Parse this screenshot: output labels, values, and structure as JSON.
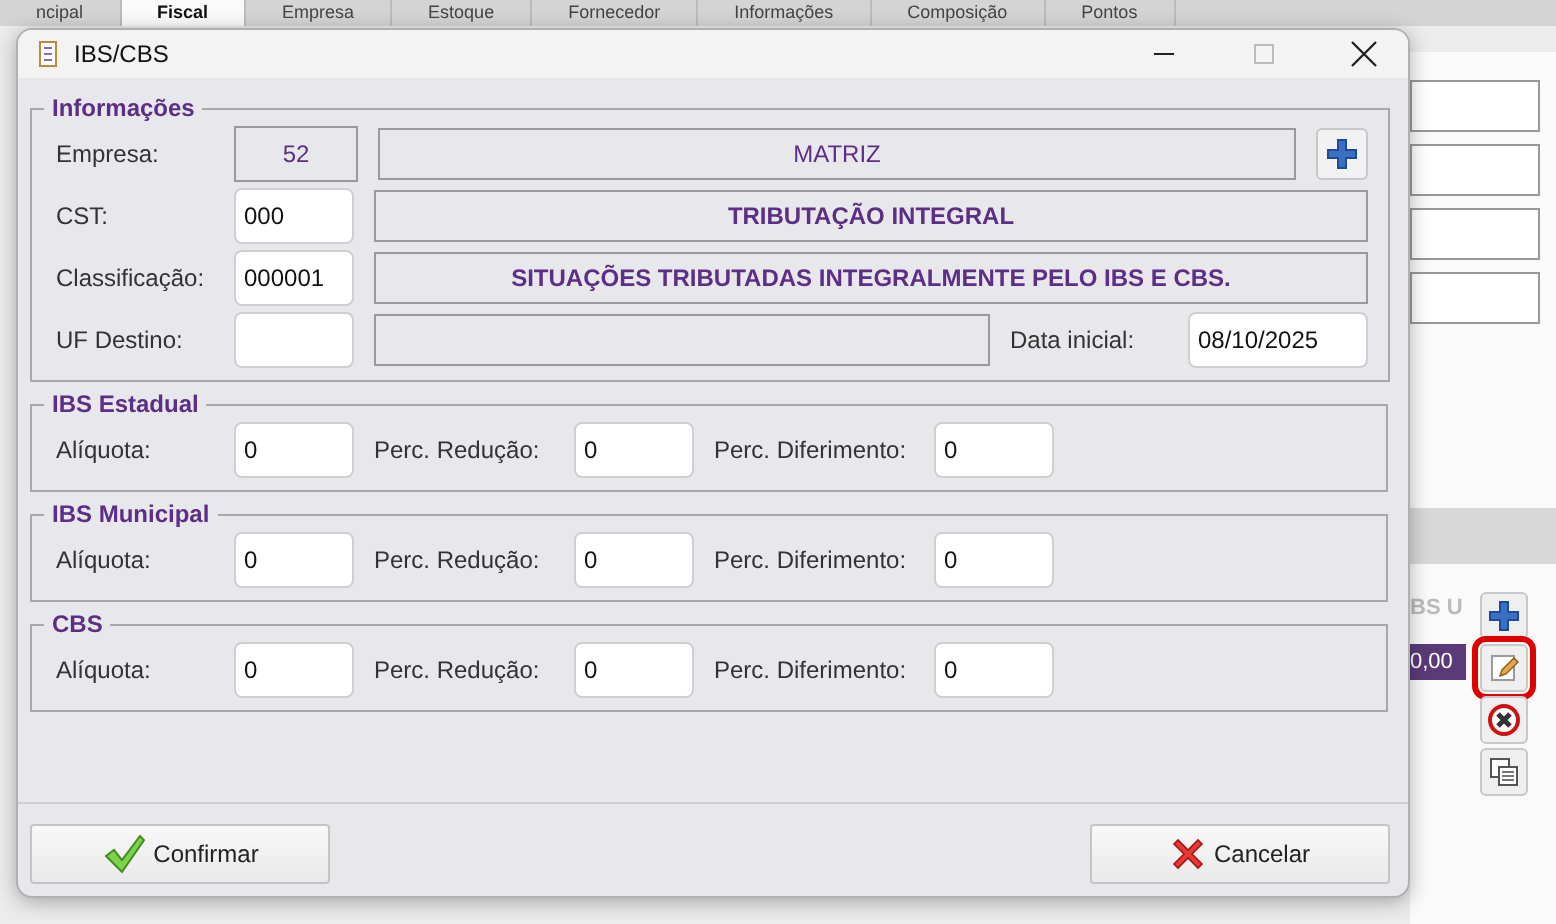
{
  "background": {
    "tabs": [
      {
        "label": "ncipal",
        "selected": false
      },
      {
        "label": "Fiscal",
        "selected": true
      },
      {
        "label": "Empresa",
        "selected": false
      },
      {
        "label": "Estoque",
        "selected": false
      },
      {
        "label": "Fornecedor",
        "selected": false
      },
      {
        "label": "Informações",
        "selected": false
      },
      {
        "label": "Composição",
        "selected": false
      },
      {
        "label": "Pontos",
        "selected": false
      }
    ],
    "table": {
      "header": "BS U",
      "cell": "0,00"
    },
    "side_buttons": [
      {
        "kind": "add",
        "highlighted": false
      },
      {
        "kind": "edit",
        "highlighted": true
      },
      {
        "kind": "delete",
        "highlighted": false
      },
      {
        "kind": "copy",
        "highlighted": false
      }
    ]
  },
  "window": {
    "title": "IBS/CBS"
  },
  "info": {
    "title": "Informações",
    "empresa": {
      "label": "Empresa:",
      "code": "52",
      "name": "MATRIZ"
    },
    "cst": {
      "label": "CST:",
      "code": "000",
      "description": "TRIBUTAÇÃO INTEGRAL"
    },
    "classificacao": {
      "label": "Classificação:",
      "code": "000001",
      "description": "SITUAÇÕES TRIBUTADAS INTEGRALMENTE PELO IBS E CBS."
    },
    "uf_destino": {
      "label": "UF Destino:"
    },
    "data_inicial": {
      "label": "Data inicial:",
      "value": "08/10/2025"
    }
  },
  "groups": [
    {
      "title": "IBS Estadual",
      "fields": [
        {
          "label": "Alíquota:",
          "value": "0"
        },
        {
          "label": "Perc. Redução:",
          "value": "0"
        },
        {
          "label": "Perc. Diferimento:",
          "value": "0"
        }
      ]
    },
    {
      "title": "IBS Municipal",
      "fields": [
        {
          "label": "Alíquota:",
          "value": "0"
        },
        {
          "label": "Perc. Redução:",
          "value": "0"
        },
        {
          "label": "Perc. Diferimento:",
          "value": "0"
        }
      ]
    },
    {
      "title": "CBS",
      "fields": [
        {
          "label": "Alíquota:",
          "value": "0"
        },
        {
          "label": "Perc. Redução:",
          "value": "0"
        },
        {
          "label": "Perc. Diferimento:",
          "value": "0"
        }
      ]
    }
  ],
  "buttons": [
    {
      "kind": "confirm",
      "label": "Confirmar"
    },
    {
      "kind": "cancel",
      "label": "Cancelar"
    }
  ]
}
